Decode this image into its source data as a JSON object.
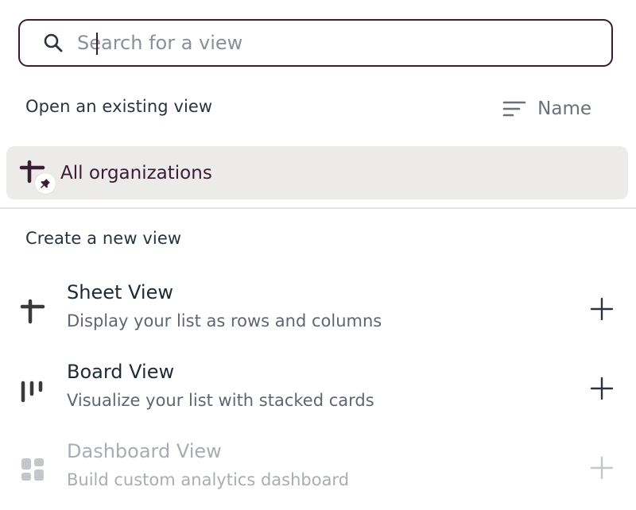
{
  "search": {
    "placeholder": "Search for a view",
    "value": ""
  },
  "existing": {
    "heading": "Open an existing view",
    "sort_label": "Name",
    "items": [
      {
        "label": "All organizations",
        "icon": "sheet-view-icon",
        "badge_icon": "pin-icon",
        "selected": true
      }
    ]
  },
  "create": {
    "heading": "Create a new view",
    "options": [
      {
        "title": "Sheet View",
        "description": "Display your list as rows and columns",
        "icon": "sheet-view-icon",
        "enabled": true
      },
      {
        "title": "Board View",
        "description": "Visualize your list with stacked cards",
        "icon": "board-view-icon",
        "enabled": true
      },
      {
        "title": "Dashboard View",
        "description": "Build custom analytics dashboard",
        "icon": "dashboard-view-icon",
        "enabled": false
      }
    ]
  },
  "colors": {
    "accent": "#3b1d33",
    "selected_row_bg": "#ecebea",
    "disabled_text": "#a9adb3"
  }
}
